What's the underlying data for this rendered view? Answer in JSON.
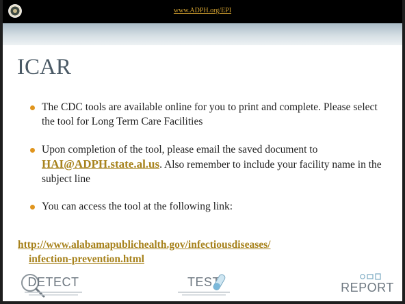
{
  "header": {
    "url": "www.ADPH.org/EPI",
    "seal_icon": "state-seal-icon"
  },
  "slide": {
    "title": "ICAR",
    "bullets": [
      {
        "text": "The CDC tools are available online for you to print and complete. Please select the tool for Long Term Care Facilities"
      },
      {
        "before": " Upon completion of the tool, please email the saved document to ",
        "email": "HAI@ADPH.state.al.us",
        "after": ". Also remember to include your facility name in the subject line"
      },
      {
        "text": "You can access the tool at the following link:"
      }
    ],
    "link": {
      "line1": "http://www.alabamapublichealth.gov/infectiousdiseases/",
      "line2": "infection-prevention.html"
    }
  },
  "logos": {
    "detect": "DETECT",
    "test": "TEST",
    "report": "REPORT"
  },
  "colors": {
    "accent": "#e0951e",
    "link": "#a7821c",
    "title": "#4a5965",
    "header_link": "#d6a431"
  }
}
